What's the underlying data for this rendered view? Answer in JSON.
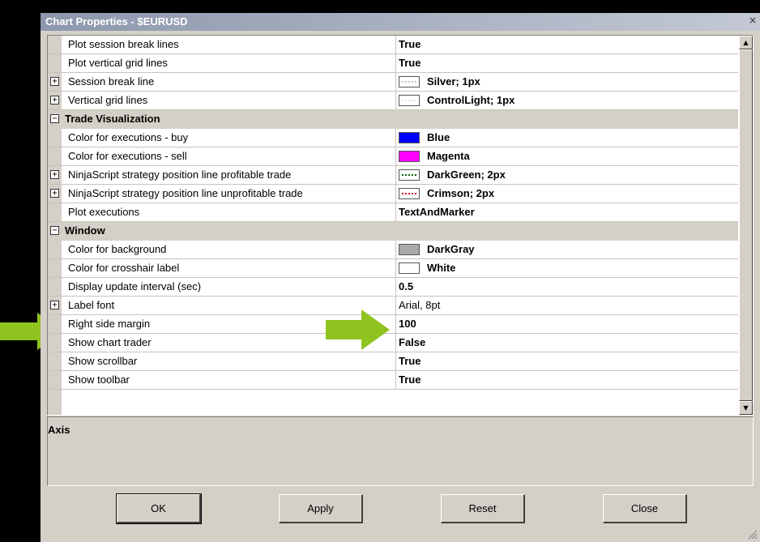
{
  "dialog": {
    "title": "Chart Properties - $EURUSD",
    "close_glyph": "×"
  },
  "properties": [
    {
      "type": "prop",
      "name": "Plot session break lines",
      "value": "True"
    },
    {
      "type": "prop",
      "name": "Plot vertical grid lines",
      "value": "True"
    },
    {
      "type": "prop",
      "expand": "+",
      "name": "Session break line",
      "value": "Silver; 1px",
      "swatch": {
        "fill": "#ffffff",
        "line": "#c0c0c0"
      }
    },
    {
      "type": "prop",
      "expand": "+",
      "name": "Vertical grid lines",
      "value": "ControlLight; 1px",
      "swatch": {
        "fill": "#ffffff",
        "line": "#e3e3e3"
      }
    },
    {
      "type": "cat",
      "expand": "−",
      "name": "Trade Visualization"
    },
    {
      "type": "prop",
      "name": "Color for executions - buy",
      "value": "Blue",
      "swatch": {
        "fill": "#0000ff"
      }
    },
    {
      "type": "prop",
      "name": "Color for executions - sell",
      "value": "Magenta",
      "swatch": {
        "fill": "#ff00ff"
      }
    },
    {
      "type": "prop",
      "expand": "+",
      "name": "NinjaScript strategy position line profitable trade",
      "value": "DarkGreen; 2px",
      "swatch": {
        "fill": "#ffffff",
        "line": "#006400"
      }
    },
    {
      "type": "prop",
      "expand": "+",
      "name": "NinjaScript strategy position line unprofitable trade",
      "value": "Crimson; 2px",
      "swatch": {
        "fill": "#ffffff",
        "line": "#dc143c"
      }
    },
    {
      "type": "prop",
      "name": "Plot executions",
      "value": "TextAndMarker"
    },
    {
      "type": "cat",
      "expand": "−",
      "name": "Window"
    },
    {
      "type": "prop",
      "name": "Color for background",
      "value": "DarkGray",
      "swatch": {
        "fill": "#a9a9a9"
      }
    },
    {
      "type": "prop",
      "name": "Color for crosshair label",
      "value": "White",
      "swatch": {
        "fill": "#ffffff"
      }
    },
    {
      "type": "prop",
      "name": "Display update interval (sec)",
      "value": "0.5"
    },
    {
      "type": "prop",
      "expand": "+",
      "name": "Label font",
      "value": "Arial, 8pt",
      "plain": true
    },
    {
      "type": "prop",
      "name": "Right side margin",
      "value": "100"
    },
    {
      "type": "prop",
      "name": "Show chart trader",
      "value": "False"
    },
    {
      "type": "prop",
      "name": "Show scrollbar",
      "value": "True"
    },
    {
      "type": "prop",
      "name": "Show toolbar",
      "value": "True"
    }
  ],
  "description": {
    "title": "Axis"
  },
  "scrollbar": {
    "up_glyph": "▲",
    "down_glyph": "▼"
  },
  "buttons": {
    "ok": "OK",
    "apply": "Apply",
    "reset": "Reset",
    "close": "Close"
  },
  "colors": {
    "highlight_arrow": "#8fc31f",
    "title_bar_start": "#8e97ad",
    "title_bar_end": "#c3c8d4",
    "dialog_face": "#d4d0c8"
  }
}
